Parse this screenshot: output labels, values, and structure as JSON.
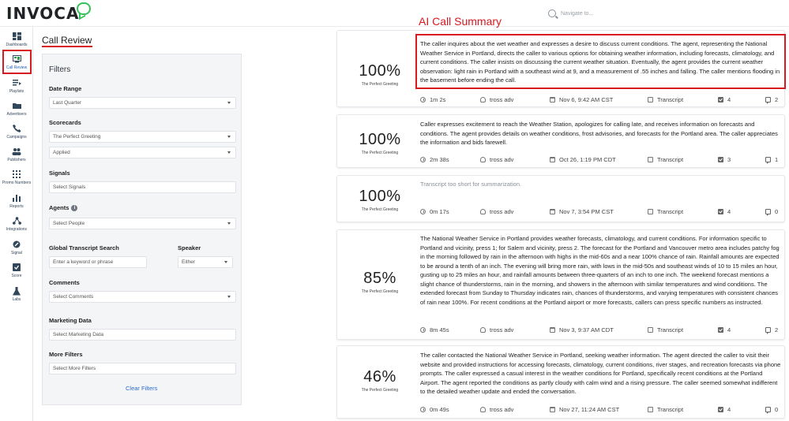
{
  "header": {
    "logo_text": "INVOCA",
    "search_placeholder": "Navigate to..."
  },
  "nav": {
    "items": [
      {
        "label": "Dashboards",
        "icon": "dashboard-icon"
      },
      {
        "label": "Call Review",
        "icon": "call-review-icon",
        "active": true
      },
      {
        "label": "Playlists",
        "icon": "playlist-icon"
      },
      {
        "label": "Advertisers",
        "icon": "folder-icon"
      },
      {
        "label": "Campaigns",
        "icon": "phone-campaign-icon"
      },
      {
        "label": "Publishers",
        "icon": "people-icon"
      },
      {
        "label": "Promo Numbers",
        "icon": "keypad-icon"
      },
      {
        "label": "Reports",
        "icon": "bar-chart-icon"
      },
      {
        "label": "Integrations",
        "icon": "integration-icon"
      },
      {
        "label": "Signal",
        "icon": "signal-icon"
      },
      {
        "label": "Score",
        "icon": "score-icon"
      },
      {
        "label": "Labs",
        "icon": "flask-icon"
      }
    ]
  },
  "page": {
    "title": "Call Review",
    "annotation": "AI Call Summary"
  },
  "filters": {
    "title": "Filters",
    "date_range": {
      "label": "Date Range",
      "value": "Last Quarter"
    },
    "scorecards": {
      "label": "Scorecards",
      "value": "The Perfect Greeting",
      "status": "Applied"
    },
    "signals": {
      "label": "Signals",
      "placeholder": "Select Signals"
    },
    "agents": {
      "label": "Agents",
      "placeholder": "Select People"
    },
    "transcript_search": {
      "label": "Global Transcript Search",
      "placeholder": "Enter a keyword or phrase"
    },
    "speaker": {
      "label": "Speaker",
      "value": "Either"
    },
    "comments": {
      "label": "Comments",
      "placeholder": "Select Comments"
    },
    "marketing": {
      "label": "Marketing Data",
      "placeholder": "Select Marketing Data"
    },
    "more": {
      "label": "More Filters",
      "placeholder": "Select More Filters"
    },
    "clear_label": "Clear Filters"
  },
  "calls": [
    {
      "score": "100%",
      "scorecard": "The Perfect Greeting",
      "summary": "The caller inquires about the wet weather and expresses a desire to discuss current conditions. The agent, representing the National Weather Service in Portland, directs the caller to various options for obtaining weather information, including forecasts, climatology, and current conditions. The caller insists on discussing the current weather situation. Eventually, the agent provides the current weather observation: light rain in Portland with a southeast wind at 9, and a measurement of .55 inches and falling. The caller mentions flooding in the basement before ending the call.",
      "duration": "1m 2s",
      "agent": "tross adv",
      "date": "Nov 6, 9:42 AM CST",
      "transcript": "Transcript",
      "checks": "4",
      "comments": "2"
    },
    {
      "score": "100%",
      "scorecard": "The Perfect Greeting",
      "summary": "Caller expresses excitement to reach the Weather Station, apologizes for calling late, and receives information on forecasts and conditions. The agent provides details on weather conditions, frost advisories, and forecasts for the Portland area. The caller appreciates the information and bids farewell.",
      "duration": "2m 38s",
      "agent": "tross adv",
      "date": "Oct 26, 1:19 PM CDT",
      "transcript": "Transcript",
      "checks": "3",
      "comments": "1"
    },
    {
      "score": "100%",
      "scorecard": "The Perfect Greeting",
      "summary": "Transcript too short for summarization.",
      "duration": "0m 17s",
      "agent": "tross adv",
      "date": "Nov 7, 3:54 PM CST",
      "transcript": "Transcript",
      "checks": "4",
      "comments": "0"
    },
    {
      "score": "85%",
      "scorecard": "The Perfect Greeting",
      "summary": "The National Weather Service in Portland provides weather forecasts, climatology, and current conditions. For information specific to Portland and vicinity, press 1; for Salem and vicinity, press 2. The forecast for the Portland and Vancouver metro area includes patchy fog in the morning followed by rain in the afternoon with highs in the mid-60s and a near 100% chance of rain. Rainfall amounts are expected to be around a tenth of an inch. The evening will bring more rain, with lows in the mid-50s and southeast winds of 10 to 15 miles an hour, gusting up to 25 miles an hour, and rainfall amounts between three-quarters of an inch to one inch. The weekend forecast mentions a slight chance of thunderstorms, rain in the morning, and showers in the afternoon with similar temperatures and wind conditions. The extended forecast from Sunday to Thursday indicates rain, chances of thunderstorms, and varying temperatures with consistent chances of rain near 100%. For recent conditions at the Portland airport or more forecasts, callers can press specific numbers as instructed.",
      "duration": "8m 45s",
      "agent": "tross adv",
      "date": "Nov 3, 9:37 AM CDT",
      "transcript": "Transcript",
      "checks": "4",
      "comments": "2"
    },
    {
      "score": "46%",
      "scorecard": "The Perfect Greeting",
      "summary": "The caller contacted the National Weather Service in Portland, seeking weather information. The agent directed the caller to visit their website and provided instructions for accessing forecasts, climatology, current conditions, river stages, and recreation forecasts via phone prompts. The caller expressed a casual interest in the weather conditions for Portland, specifically recent conditions at the Portland Airport. The agent reported the conditions as partly cloudy with calm wind and a rising pressure. The caller seemed somewhat indifferent to the detailed weather update and ended the conversation.",
      "duration": "0m 49s",
      "agent": "tross adv",
      "date": "Nov 27, 11:24 AM CST",
      "transcript": "Transcript",
      "checks": "4",
      "comments": "0"
    }
  ],
  "colors": {
    "accent_red": "#d8191f",
    "link_blue": "#2c6ccf",
    "brand_green": "#35c25a"
  }
}
